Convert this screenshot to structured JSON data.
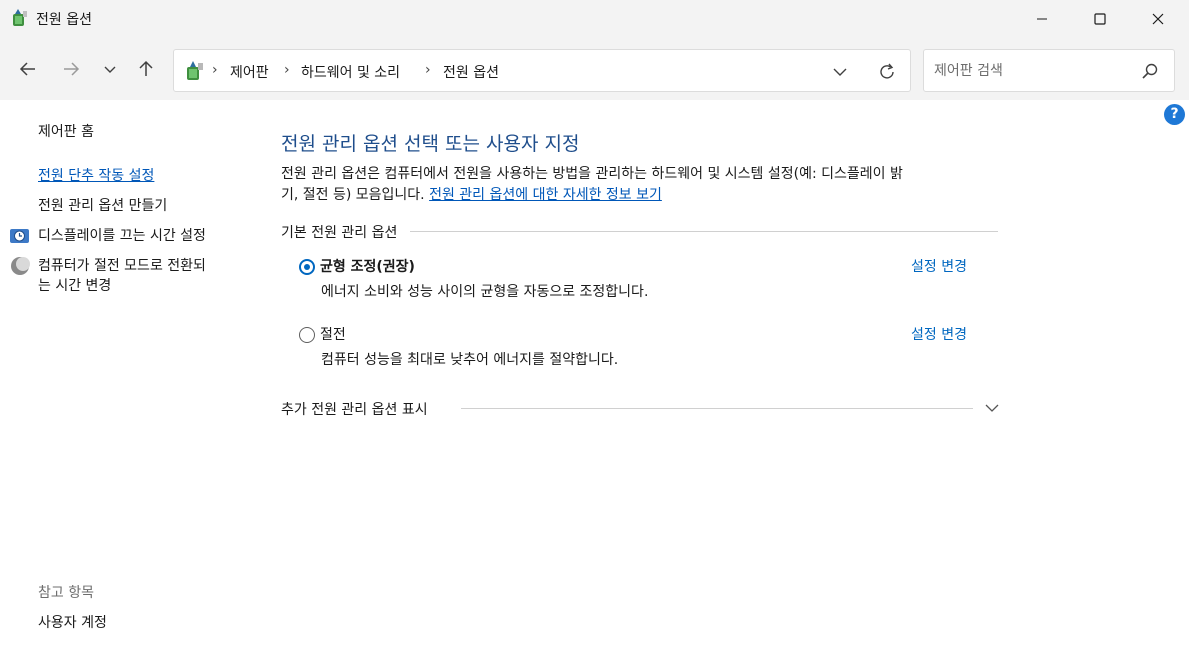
{
  "window": {
    "title": "전원 옵션"
  },
  "address_bar": {
    "crumbs": [
      "제어판",
      "하드웨어 및 소리",
      "전원 옵션"
    ]
  },
  "search": {
    "placeholder": "제어판 검색"
  },
  "help": {
    "label": "?"
  },
  "sidebar": {
    "home": "제어판 홈",
    "links": [
      {
        "label": "전원 단추 작동 설정"
      },
      {
        "label": "전원 관리 옵션 만들기"
      },
      {
        "label": "디스플레이를 끄는 시간 설정"
      },
      {
        "label_line1": "컴퓨터가 절전 모드로 전환되",
        "label_line2": "는 시간 변경"
      }
    ],
    "see_also": "참고 항목",
    "user_accounts": "사용자 계정"
  },
  "main": {
    "title": "전원 관리 옵션 선택 또는 사용자 지정",
    "desc_line1": "전원 관리 옵션은 컴퓨터에서 전원을 사용하는 방법을 관리하는 하드웨어 및 시스템 설정(예: 디스플레이 밝",
    "desc_line2": "기, 절전 등) 모음입니다.",
    "desc_link": "전원 관리 옵션에 대한 자세한 정보 보기",
    "section_title": "기본 전원 관리 옵션",
    "plans": [
      {
        "name": "균형 조정(권장)",
        "description": "에너지 소비와 성능 사이의 균형을 자동으로 조정합니다.",
        "link": "설정 변경",
        "selected": true
      },
      {
        "name": "절전",
        "description": "컴퓨터 성능을 최대로 낮추어 에너지를 절약합니다.",
        "link": "설정 변경",
        "selected": false
      }
    ],
    "more_plans": "추가 전원 관리 옵션 표시"
  },
  "colors": {
    "accent": "#0067c0",
    "title_blue": "#1f4e8c",
    "link": "#0057b8"
  }
}
